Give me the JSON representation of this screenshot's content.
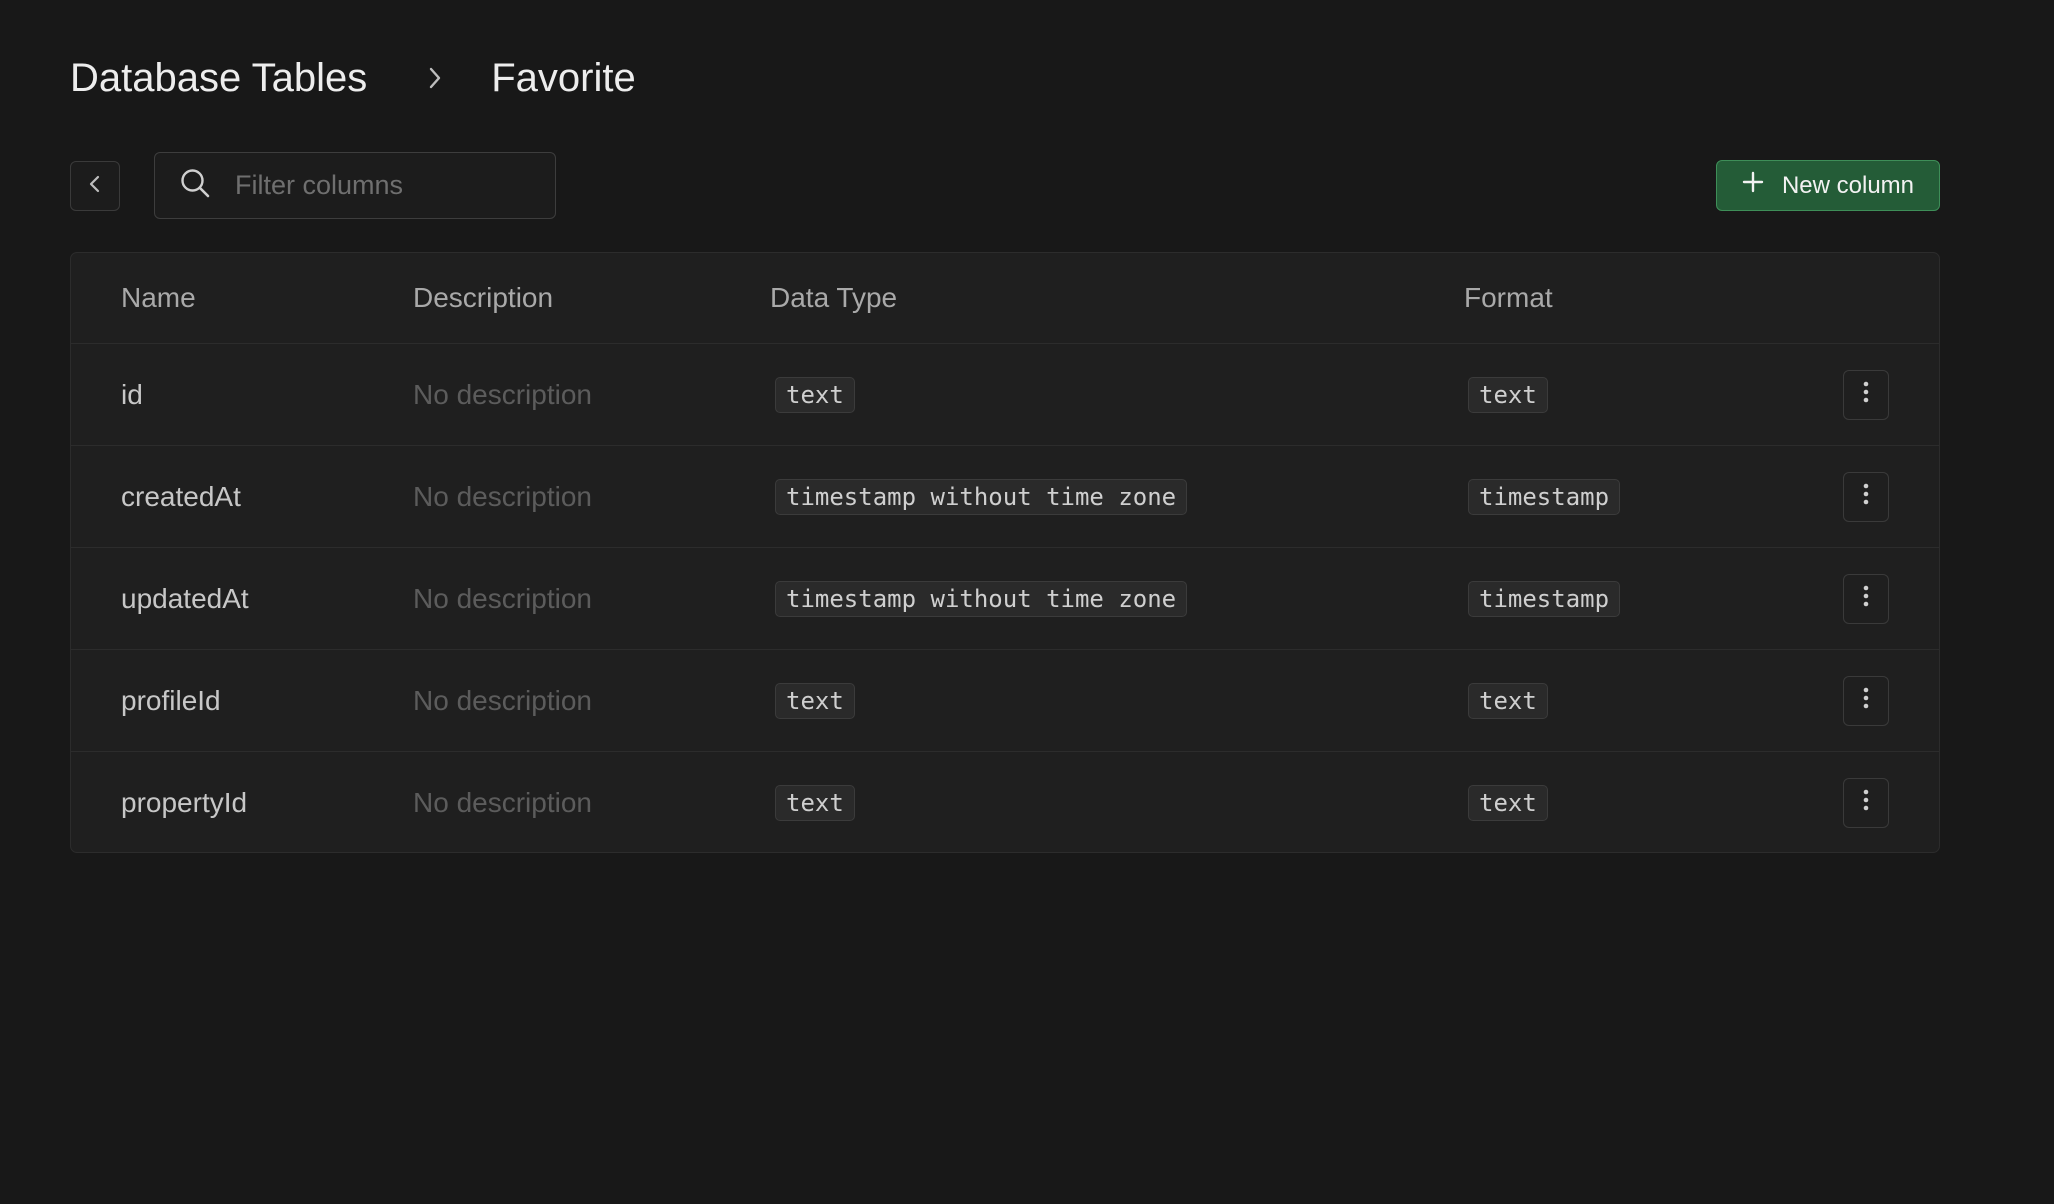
{
  "breadcrumb": {
    "parent": "Database Tables",
    "current": "Favorite",
    "separator_icon": "chevron-right-icon"
  },
  "toolbar": {
    "back_icon": "chevron-left-icon",
    "search_icon": "search-icon",
    "search_placeholder": "Filter columns",
    "search_value": "",
    "new_column_icon": "plus-icon",
    "new_column_label": "New column"
  },
  "table": {
    "headers": {
      "name": "Name",
      "description": "Description",
      "data_type": "Data Type",
      "format": "Format"
    },
    "rows": [
      {
        "name": "id",
        "description": "No description",
        "data_type": "text",
        "format": "text"
      },
      {
        "name": "createdAt",
        "description": "No description",
        "data_type": "timestamp without time zone",
        "format": "timestamp"
      },
      {
        "name": "updatedAt",
        "description": "No description",
        "data_type": "timestamp without time zone",
        "format": "timestamp"
      },
      {
        "name": "profileId",
        "description": "No description",
        "data_type": "text",
        "format": "text"
      },
      {
        "name": "propertyId",
        "description": "No description",
        "data_type": "text",
        "format": "text"
      }
    ],
    "row_action_icon": "more-vertical-icon"
  },
  "colors": {
    "background": "#181818",
    "surface": "#1f1f1f",
    "border": "#2c2c2c",
    "primary_button": "#245c37",
    "primary_button_border": "#3e8e58",
    "muted_text": "#5c5c5c"
  }
}
